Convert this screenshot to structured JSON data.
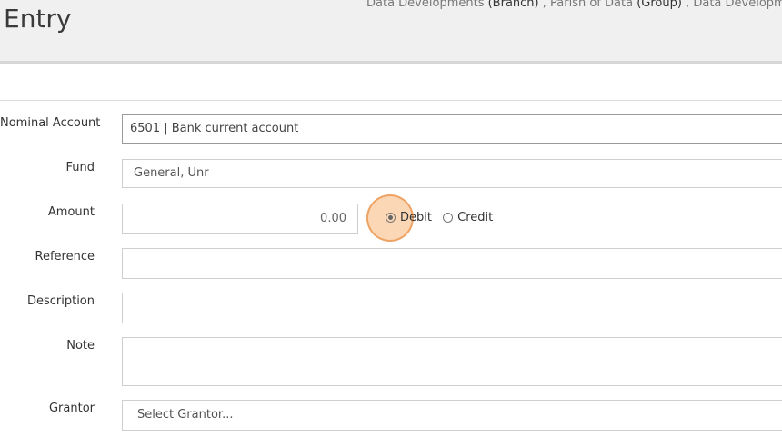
{
  "header": {
    "title": "Entry",
    "breadcrumb": {
      "branch_name": "Data Developments",
      "branch_tag": "(Branch)",
      "sep1": ",",
      "group_name": "Parish of Data",
      "group_tag": "(Group)",
      "sep2": ",",
      "third_name": "Data Development"
    }
  },
  "form": {
    "nominal_account": {
      "label": "Nominal Account",
      "value": "6501 | Bank current account"
    },
    "fund": {
      "label": "Fund",
      "value": "General, Unr"
    },
    "amount": {
      "label": "Amount",
      "value": "0.00",
      "debit_label": "Debit",
      "credit_label": "Credit",
      "selected": "Debit"
    },
    "reference": {
      "label": "Reference",
      "value": ""
    },
    "description": {
      "label": "Description",
      "value": ""
    },
    "note": {
      "label": "Note",
      "value": ""
    },
    "grantor": {
      "label": "Grantor",
      "placeholder": "Select Grantor..."
    }
  },
  "colors": {
    "click_highlight": "#f7b678"
  }
}
